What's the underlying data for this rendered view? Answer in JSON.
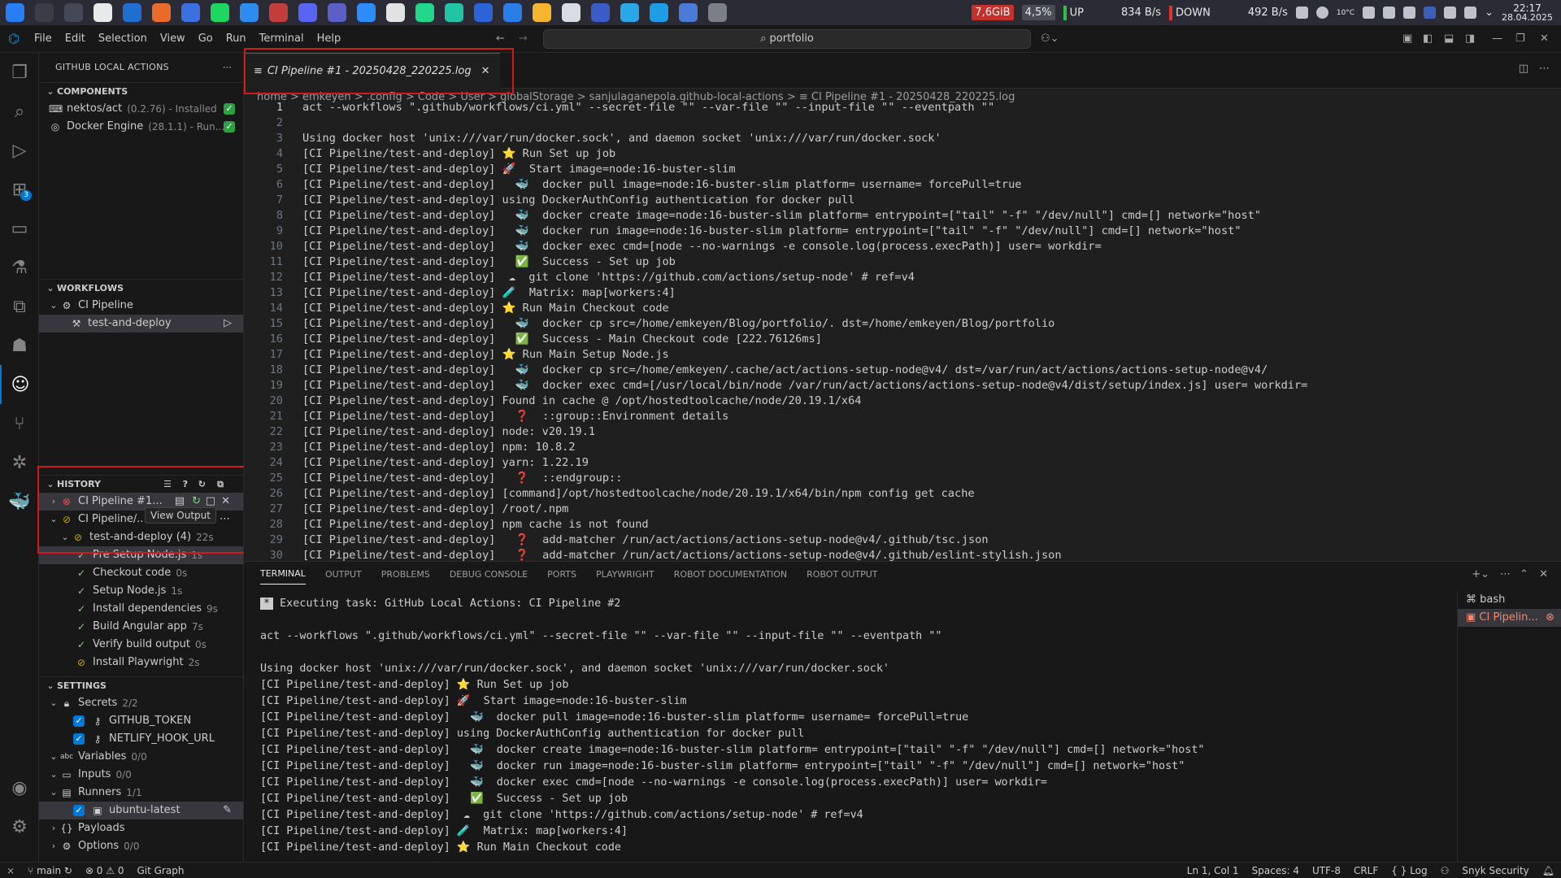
{
  "taskbar": {
    "ram": "7,6GiB",
    "cpu": "4,5%",
    "up_label": "UP",
    "up_speed": "834 B/s",
    "down_label": "DOWN",
    "down_speed": "492 B/s",
    "temp": "10°C",
    "time": "22:17",
    "date": "28.04.2025"
  },
  "menu": [
    "File",
    "Edit",
    "Selection",
    "View",
    "Go",
    "Run",
    "Terminal",
    "Help"
  ],
  "search": "portfolio",
  "sidebar": {
    "title": "GITHUB LOCAL ACTIONS",
    "components_header": "COMPONENTS",
    "components": [
      {
        "name": "nektos/act",
        "detail": "(0.2.76) - Installed"
      },
      {
        "name": "Docker Engine",
        "detail": "(28.1.1) - Run..."
      }
    ],
    "workflows_header": "WORKFLOWS",
    "workflow": "CI Pipeline",
    "job": "test-and-deploy",
    "history_header": "HISTORY",
    "history": [
      {
        "name": "CI Pipeline #1..."
      },
      {
        "name": "CI Pipeline/..."
      }
    ],
    "history_job": "test-and-deploy (4)",
    "history_job_time": "22s",
    "steps": [
      {
        "name": "Pre Setup Node.js",
        "time": "1s",
        "status": "ok"
      },
      {
        "name": "Checkout code",
        "time": "0s",
        "status": "ok"
      },
      {
        "name": "Setup Node.js",
        "time": "1s",
        "status": "ok"
      },
      {
        "name": "Install dependencies",
        "time": "9s",
        "status": "ok"
      },
      {
        "name": "Build Angular app",
        "time": "7s",
        "status": "ok"
      },
      {
        "name": "Verify build output",
        "time": "0s",
        "status": "ok"
      },
      {
        "name": "Install Playwright",
        "time": "2s",
        "status": "warn"
      }
    ],
    "settings_header": "SETTINGS",
    "secrets": "Secrets",
    "secrets_count": "2/2",
    "secret_items": [
      "GITHUB_TOKEN",
      "NETLIFY_HOOK_URL"
    ],
    "variables": "Variables",
    "variables_count": "0/0",
    "inputs": "Inputs",
    "inputs_count": "0/0",
    "runners": "Runners",
    "runners_count": "1/1",
    "runner_item": "ubuntu-latest",
    "payloads": "Payloads",
    "options": "Options",
    "options_count": "0/0",
    "tooltip": "View Output"
  },
  "editor": {
    "tab": "CI Pipeline #1 - 20250428_220225.log",
    "breadcrumb": "home > emkeyen > .config > Code > User > globalStorage > sanjulaganepola.github-local-actions > ≡ CI Pipeline #1 - 20250428_220225.log",
    "lines": [
      "act --workflows \".github/workflows/ci.yml\" --secret-file \"\" --var-file \"\" --input-file \"\" --eventpath \"\"",
      "",
      "Using docker host 'unix:///var/run/docker.sock', and daemon socket 'unix:///var/run/docker.sock'",
      "[CI Pipeline/test-and-deploy] ⭐ Run Set up job",
      "[CI Pipeline/test-and-deploy] 🚀  Start image=node:16-buster-slim",
      "[CI Pipeline/test-and-deploy]   🐳  docker pull image=node:16-buster-slim platform= username= forcePull=true",
      "[CI Pipeline/test-and-deploy] using DockerAuthConfig authentication for docker pull",
      "[CI Pipeline/test-and-deploy]   🐳  docker create image=node:16-buster-slim platform= entrypoint=[\"tail\" \"-f\" \"/dev/null\"] cmd=[] network=\"host\"",
      "[CI Pipeline/test-and-deploy]   🐳  docker run image=node:16-buster-slim platform= entrypoint=[\"tail\" \"-f\" \"/dev/null\"] cmd=[] network=\"host\"",
      "[CI Pipeline/test-and-deploy]   🐳  docker exec cmd=[node --no-warnings -e console.log(process.execPath)] user= workdir=",
      "[CI Pipeline/test-and-deploy]   ✅  Success - Set up job",
      "[CI Pipeline/test-and-deploy]  ☁  git clone 'https://github.com/actions/setup-node' # ref=v4",
      "[CI Pipeline/test-and-deploy] 🧪  Matrix: map[workers:4]",
      "[CI Pipeline/test-and-deploy] ⭐ Run Main Checkout code",
      "[CI Pipeline/test-and-deploy]   🐳  docker cp src=/home/emkeyen/Blog/portfolio/. dst=/home/emkeyen/Blog/portfolio",
      "[CI Pipeline/test-and-deploy]   ✅  Success - Main Checkout code [222.76126ms]",
      "[CI Pipeline/test-and-deploy] ⭐ Run Main Setup Node.js",
      "[CI Pipeline/test-and-deploy]   🐳  docker cp src=/home/emkeyen/.cache/act/actions-setup-node@v4/ dst=/var/run/act/actions/actions-setup-node@v4/",
      "[CI Pipeline/test-and-deploy]   🐳  docker exec cmd=[/usr/local/bin/node /var/run/act/actions/actions-setup-node@v4/dist/setup/index.js] user= workdir=",
      "[CI Pipeline/test-and-deploy] Found in cache @ /opt/hostedtoolcache/node/20.19.1/x64",
      "[CI Pipeline/test-and-deploy]   ❓  ::group::Environment details",
      "[CI Pipeline/test-and-deploy] node: v20.19.1",
      "[CI Pipeline/test-and-deploy] npm: 10.8.2",
      "[CI Pipeline/test-and-deploy] yarn: 1.22.19",
      "[CI Pipeline/test-and-deploy]   ❓  ::endgroup::",
      "[CI Pipeline/test-and-deploy] [command]/opt/hostedtoolcache/node/20.19.1/x64/bin/npm config get cache",
      "[CI Pipeline/test-and-deploy] /root/.npm",
      "[CI Pipeline/test-and-deploy] npm cache is not found",
      "[CI Pipeline/test-and-deploy]   ❓  add-matcher /run/act/actions/actions-setup-node@v4/.github/tsc.json",
      "[CI Pipeline/test-and-deploy]   ❓  add-matcher /run/act/actions/actions-setup-node@v4/.github/eslint-stylish.json"
    ]
  },
  "panel": {
    "tabs": [
      "TERMINAL",
      "OUTPUT",
      "PROBLEMS",
      "DEBUG CONSOLE",
      "PORTS",
      "PLAYWRIGHT",
      "ROBOT DOCUMENTATION",
      "ROBOT OUTPUT"
    ],
    "task_line": "Executing task: GitHub Local Actions: CI Pipeline #2",
    "lines": [
      "act --workflows \".github/workflows/ci.yml\" --secret-file \"\" --var-file \"\" --input-file \"\" --eventpath \"\"",
      "",
      "Using docker host 'unix:///var/run/docker.sock', and daemon socket 'unix:///var/run/docker.sock'",
      "[CI Pipeline/test-and-deploy] ⭐ Run Set up job",
      "[CI Pipeline/test-and-deploy] 🚀  Start image=node:16-buster-slim",
      "[CI Pipeline/test-and-deploy]   🐳  docker pull image=node:16-buster-slim platform= username= forcePull=true",
      "[CI Pipeline/test-and-deploy] using DockerAuthConfig authentication for docker pull",
      "[CI Pipeline/test-and-deploy]   🐳  docker create image=node:16-buster-slim platform= entrypoint=[\"tail\" \"-f\" \"/dev/null\"] cmd=[] network=\"host\"",
      "[CI Pipeline/test-and-deploy]   🐳  docker run image=node:16-buster-slim platform= entrypoint=[\"tail\" \"-f\" \"/dev/null\"] cmd=[] network=\"host\"",
      "[CI Pipeline/test-and-deploy]   🐳  docker exec cmd=[node --no-warnings -e console.log(process.execPath)] user= workdir=",
      "[CI Pipeline/test-and-deploy]   ✅  Success - Set up job",
      "[CI Pipeline/test-and-deploy]  ☁  git clone 'https://github.com/actions/setup-node' # ref=v4",
      "[CI Pipeline/test-and-deploy] 🧪  Matrix: map[workers:4]",
      "[CI Pipeline/test-and-deploy] ⭐ Run Main Checkout code"
    ],
    "terminals": [
      "bash",
      "CI Pipelin..."
    ]
  },
  "status": {
    "branch": "main",
    "problems": "⊗ 0 ⚠ 0",
    "git_graph": "Git Graph",
    "position": "Ln 1, Col 1",
    "spaces": "Spaces: 4",
    "encoding": "UTF-8",
    "eol": "CRLF",
    "language": "{ } Log",
    "snyk": "Snyk Security"
  }
}
